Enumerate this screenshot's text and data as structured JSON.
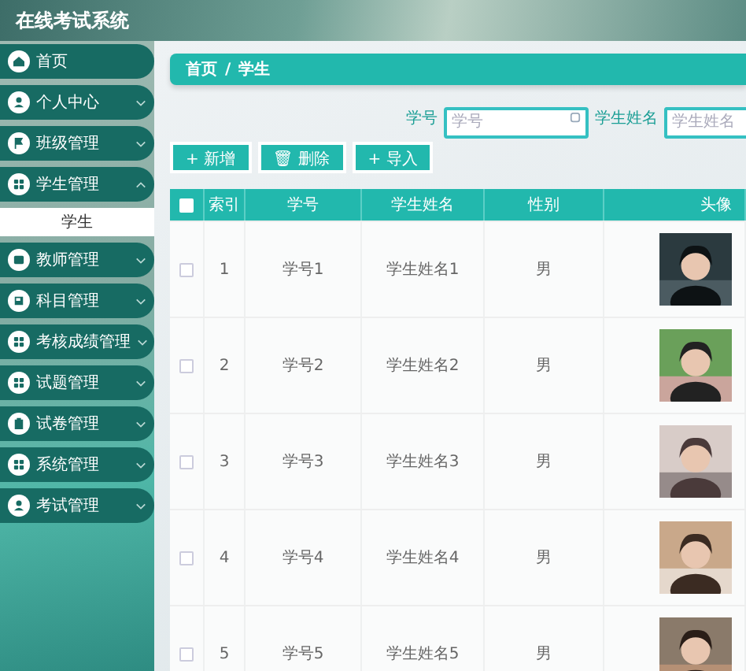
{
  "header": {
    "title": "在线考试系统"
  },
  "sidebar": {
    "items": [
      {
        "label": "首页",
        "kind": "link"
      },
      {
        "label": "个人中心",
        "kind": "menu",
        "expanded": false
      },
      {
        "label": "班级管理",
        "kind": "menu",
        "expanded": false
      },
      {
        "label": "学生管理",
        "kind": "menu",
        "expanded": true,
        "children": [
          {
            "label": "学生",
            "selected": true
          }
        ]
      },
      {
        "label": "教师管理",
        "kind": "menu",
        "expanded": false
      },
      {
        "label": "科目管理",
        "kind": "menu",
        "expanded": false
      },
      {
        "label": "考核成绩管理",
        "kind": "menu",
        "expanded": false
      },
      {
        "label": "试题管理",
        "kind": "menu",
        "expanded": false
      },
      {
        "label": "试卷管理",
        "kind": "menu",
        "expanded": false
      },
      {
        "label": "系统管理",
        "kind": "menu",
        "expanded": false
      },
      {
        "label": "考试管理",
        "kind": "menu",
        "expanded": false
      }
    ]
  },
  "breadcrumb": [
    "首页",
    "/",
    "学生"
  ],
  "search": [
    {
      "label": "学号",
      "placeholder": "学号"
    },
    {
      "label": "学生姓名",
      "placeholder": "学生姓名"
    }
  ],
  "buttons": [
    {
      "icon": "+",
      "label": "新增"
    },
    {
      "icon": "🗑",
      "label": "删除"
    },
    {
      "icon": "+",
      "label": "导入"
    }
  ],
  "table": {
    "header_checked": false,
    "columns": [
      "索引",
      "学号",
      "学生姓名",
      "性别",
      "头像"
    ],
    "rows": [
      {
        "checked": false,
        "cells": [
          "1",
          "学号1",
          "学生姓名1",
          "男"
        ],
        "photo": {
          "kind": "picture"
        }
      },
      {
        "checked": false,
        "cells": [
          "2",
          "学号2",
          "学生姓名2",
          "男"
        ],
        "photo": {
          "kind": "picture"
        }
      },
      {
        "checked": false,
        "cells": [
          "3",
          "学号3",
          "学生姓名3",
          "男"
        ],
        "photo": {
          "kind": "picture"
        }
      },
      {
        "checked": false,
        "cells": [
          "4",
          "学号4",
          "学生姓名4",
          "男"
        ],
        "photo": {
          "kind": "picture"
        }
      },
      {
        "checked": false,
        "cells": [
          "5",
          "学号5",
          "学生姓名5",
          "男"
        ],
        "photo": {
          "kind": "picture"
        }
      }
    ]
  }
}
